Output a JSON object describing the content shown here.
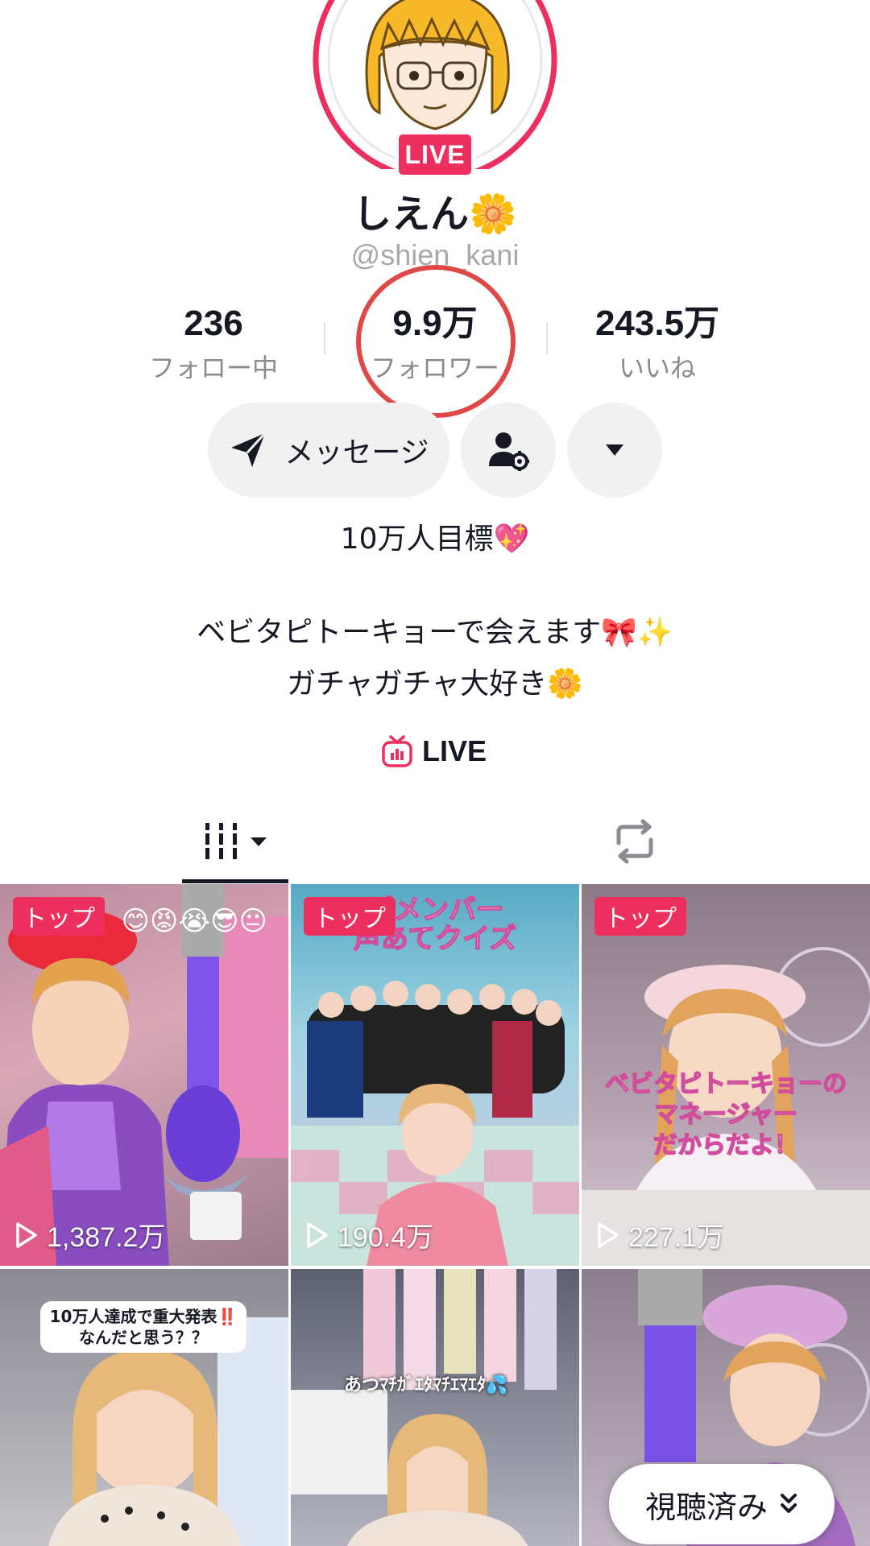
{
  "profile": {
    "live_badge": "LIVE",
    "display_name": "しえん🌼",
    "handle": "@shien_kani"
  },
  "stats": [
    {
      "value": "236",
      "label": "フォロー中"
    },
    {
      "value": "9.9万",
      "label": "フォロワー"
    },
    {
      "value": "243.5万",
      "label": "いいね"
    }
  ],
  "actions": {
    "message_label": "メッセージ",
    "person_icon": "person-settings-icon",
    "more_icon": "caret-down-icon"
  },
  "bio": {
    "goal": "10万人目標💖",
    "line1": "ベビタピトーキョーで会えます🎀✨",
    "line2": "ガチャガチャ大好き🌼",
    "live_link": "LIVE"
  },
  "tabs": [
    {
      "name": "videos",
      "icon": "grid-icon",
      "active": true
    },
    {
      "name": "reposts",
      "icon": "repost-icon",
      "active": false
    }
  ],
  "videos": [
    {
      "badge": "トップ",
      "views": "1,387.2万",
      "overlay": "😊😡😭😎😐"
    },
    {
      "badge": "トップ",
      "views": "190.4万",
      "overlay": "ピメンバー\n声あてクイズ"
    },
    {
      "badge": "トップ",
      "views": "227.1万",
      "overlay": "ベビタピトーキョーの\nマネージャー\nだからだよ！"
    },
    {
      "badge": "",
      "views": "",
      "overlay": "10万人達成で重大発表‼️\nなんだと思う？？"
    },
    {
      "badge": "",
      "views": "",
      "overlay": "あつﾏﾁｶﾞｴﾀﾏﾁｴﾏｴﾀ💦"
    },
    {
      "badge": "",
      "views": "",
      "overlay": ""
    }
  ],
  "watched_pill": "視聴済み",
  "colors": {
    "accent": "#ec2f5f",
    "text": "#161823",
    "muted": "#8a8b91"
  }
}
